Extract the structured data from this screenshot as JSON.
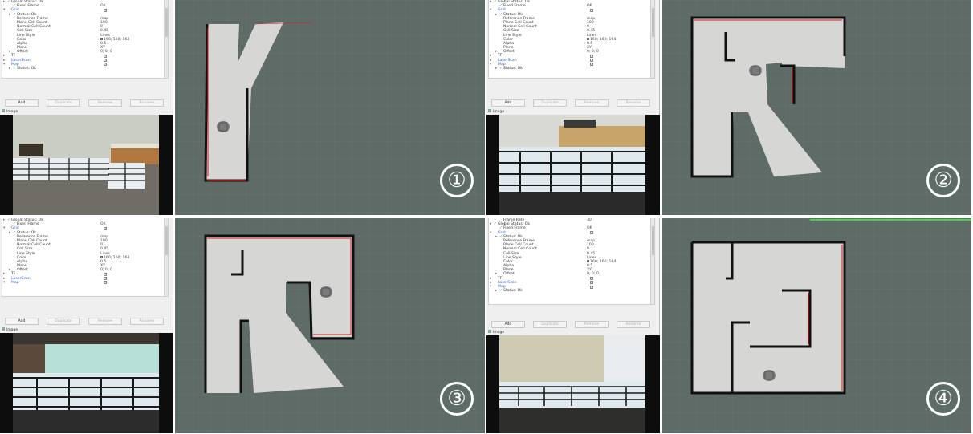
{
  "panels": [
    {
      "marker": "①",
      "tree": [
        {
          "indent": 0,
          "tw": "▸",
          "ck": "✓",
          "label": "Global Status: Ok",
          "value": ""
        },
        {
          "indent": 1,
          "tw": "",
          "ck": "✓",
          "label": "Fixed Frame",
          "value": "OK"
        },
        {
          "indent": 0,
          "tw": "▾",
          "ck": "",
          "label": "Grid",
          "value": "",
          "blue": true,
          "box": "✓"
        },
        {
          "indent": 1,
          "tw": "▸",
          "ck": "✓",
          "label": "Status: Ok",
          "value": ""
        },
        {
          "indent": 1,
          "tw": "",
          "ck": "",
          "label": "Reference Frame",
          "value": "map"
        },
        {
          "indent": 1,
          "tw": "",
          "ck": "",
          "label": "Plane Cell Count",
          "value": "100"
        },
        {
          "indent": 1,
          "tw": "",
          "ck": "",
          "label": "Normal Cell Count",
          "value": "0"
        },
        {
          "indent": 1,
          "tw": "",
          "ck": "",
          "label": "Cell Size",
          "value": "0.45"
        },
        {
          "indent": 1,
          "tw": "",
          "ck": "",
          "label": "Line Style",
          "value": "Lines"
        },
        {
          "indent": 1,
          "tw": "",
          "ck": "",
          "label": "Color",
          "value": "160; 160; 164",
          "swatch": true
        },
        {
          "indent": 1,
          "tw": "",
          "ck": "",
          "label": "Alpha",
          "value": "0.5"
        },
        {
          "indent": 1,
          "tw": "",
          "ck": "",
          "label": "Plane",
          "value": "XY"
        },
        {
          "indent": 1,
          "tw": "▸",
          "ck": "",
          "label": "Offset",
          "value": "0; 0; 0"
        },
        {
          "indent": 0,
          "tw": "▸",
          "ck": "",
          "label": "TF",
          "value": "",
          "box": "✓"
        },
        {
          "indent": 0,
          "tw": "▸",
          "ck": "",
          "label": "LaserScan",
          "value": "",
          "blue": true,
          "box": "✓"
        },
        {
          "indent": 0,
          "tw": "▾",
          "ck": "",
          "label": "Map",
          "value": "",
          "blue": true,
          "box": "✓"
        },
        {
          "indent": 1,
          "tw": "▸",
          "ck": "✓",
          "label": "Status: Ok",
          "value": ""
        }
      ]
    },
    {
      "marker": "②",
      "tree": [
        {
          "indent": 0,
          "tw": "▸",
          "ck": "✓",
          "label": "Global Status: Ok",
          "value": ""
        },
        {
          "indent": 1,
          "tw": "",
          "ck": "✓",
          "label": "Fixed Frame",
          "value": "OK"
        },
        {
          "indent": 0,
          "tw": "▾",
          "ck": "",
          "label": "Grid",
          "value": "",
          "blue": true,
          "box": "✓"
        },
        {
          "indent": 1,
          "tw": "▸",
          "ck": "✓",
          "label": "Status: Ok",
          "value": ""
        },
        {
          "indent": 1,
          "tw": "",
          "ck": "",
          "label": "Reference Frame",
          "value": "map"
        },
        {
          "indent": 1,
          "tw": "",
          "ck": "",
          "label": "Plane Cell Count",
          "value": "100"
        },
        {
          "indent": 1,
          "tw": "",
          "ck": "",
          "label": "Normal Cell Count",
          "value": "0"
        },
        {
          "indent": 1,
          "tw": "",
          "ck": "",
          "label": "Cell Size",
          "value": "0.45"
        },
        {
          "indent": 1,
          "tw": "",
          "ck": "",
          "label": "Line Style",
          "value": "Lines"
        },
        {
          "indent": 1,
          "tw": "",
          "ck": "",
          "label": "Color",
          "value": "160; 160; 164",
          "swatch": true
        },
        {
          "indent": 1,
          "tw": "",
          "ck": "",
          "label": "Alpha",
          "value": "0.5"
        },
        {
          "indent": 1,
          "tw": "",
          "ck": "",
          "label": "Plane",
          "value": "XY"
        },
        {
          "indent": 1,
          "tw": "▸",
          "ck": "",
          "label": "Offset",
          "value": "0; 0; 0"
        },
        {
          "indent": 0,
          "tw": "▸",
          "ck": "",
          "label": "TF",
          "value": "",
          "box": "✓"
        },
        {
          "indent": 0,
          "tw": "▸",
          "ck": "",
          "label": "LaserScan",
          "value": "",
          "blue": true,
          "box": "✓"
        },
        {
          "indent": 0,
          "tw": "▾",
          "ck": "",
          "label": "Map",
          "value": "",
          "blue": true,
          "box": "✓"
        },
        {
          "indent": 1,
          "tw": "▸",
          "ck": "✓",
          "label": "Status: Ok",
          "value": ""
        }
      ]
    },
    {
      "marker": "③",
      "tree": [
        {
          "indent": 0,
          "tw": "▸",
          "ck": "✓",
          "label": "Global Status: Ok",
          "value": ""
        },
        {
          "indent": 1,
          "tw": "",
          "ck": "✓",
          "label": "Fixed Frame",
          "value": "OK"
        },
        {
          "indent": 0,
          "tw": "▾",
          "ck": "",
          "label": "Grid",
          "value": "",
          "blue": true,
          "box": "✓"
        },
        {
          "indent": 1,
          "tw": "▸",
          "ck": "✓",
          "label": "Status: Ok",
          "value": ""
        },
        {
          "indent": 1,
          "tw": "",
          "ck": "",
          "label": "Reference Frame",
          "value": "map"
        },
        {
          "indent": 1,
          "tw": "",
          "ck": "",
          "label": "Plane Cell Count",
          "value": "100"
        },
        {
          "indent": 1,
          "tw": "",
          "ck": "",
          "label": "Normal Cell Count",
          "value": "0"
        },
        {
          "indent": 1,
          "tw": "",
          "ck": "",
          "label": "Cell Size",
          "value": "0.45"
        },
        {
          "indent": 1,
          "tw": "",
          "ck": "",
          "label": "Line Style",
          "value": "Lines"
        },
        {
          "indent": 1,
          "tw": "",
          "ck": "",
          "label": "Color",
          "value": "160; 160; 164",
          "swatch": true
        },
        {
          "indent": 1,
          "tw": "",
          "ck": "",
          "label": "Alpha",
          "value": "0.5"
        },
        {
          "indent": 1,
          "tw": "",
          "ck": "",
          "label": "Plane",
          "value": "XY"
        },
        {
          "indent": 1,
          "tw": "▸",
          "ck": "",
          "label": "Offset",
          "value": "0; 0; 0"
        },
        {
          "indent": 0,
          "tw": "▸",
          "ck": "",
          "label": "TF",
          "value": "",
          "box": "✓"
        },
        {
          "indent": 0,
          "tw": "▸",
          "ck": "",
          "label": "LaserScan",
          "value": "",
          "blue": true,
          "box": "✓"
        },
        {
          "indent": 0,
          "tw": "▾",
          "ck": "",
          "label": "Map",
          "value": "",
          "blue": true,
          "box": "✓"
        }
      ]
    },
    {
      "marker": "④",
      "tree": [
        {
          "indent": 1,
          "tw": "",
          "ck": "",
          "label": "Frame Rate",
          "value": "30"
        },
        {
          "indent": 0,
          "tw": "▸",
          "ck": "✓",
          "label": "Global Status: Ok",
          "value": ""
        },
        {
          "indent": 1,
          "tw": "",
          "ck": "✓",
          "label": "Fixed Frame",
          "value": "OK"
        },
        {
          "indent": 0,
          "tw": "▾",
          "ck": "",
          "label": "Grid",
          "value": "",
          "blue": true,
          "box": "✓"
        },
        {
          "indent": 1,
          "tw": "▸",
          "ck": "✓",
          "label": "Status: Ok",
          "value": ""
        },
        {
          "indent": 1,
          "tw": "",
          "ck": "",
          "label": "Reference Frame",
          "value": "map"
        },
        {
          "indent": 1,
          "tw": "",
          "ck": "",
          "label": "Plane Cell Count",
          "value": "100"
        },
        {
          "indent": 1,
          "tw": "",
          "ck": "",
          "label": "Normal Cell Count",
          "value": "0"
        },
        {
          "indent": 1,
          "tw": "",
          "ck": "",
          "label": "Cell Size",
          "value": "0.45"
        },
        {
          "indent": 1,
          "tw": "",
          "ck": "",
          "label": "Line Style",
          "value": "Lines"
        },
        {
          "indent": 1,
          "tw": "",
          "ck": "",
          "label": "Color",
          "value": "160; 160; 164",
          "swatch": true
        },
        {
          "indent": 1,
          "tw": "",
          "ck": "",
          "label": "Alpha",
          "value": "0.5"
        },
        {
          "indent": 1,
          "tw": "",
          "ck": "",
          "label": "Plane",
          "value": "XY"
        },
        {
          "indent": 1,
          "tw": "▸",
          "ck": "",
          "label": "Offset",
          "value": "0; 0; 0"
        },
        {
          "indent": 0,
          "tw": "▸",
          "ck": "",
          "label": "TF",
          "value": "",
          "box": "✓"
        },
        {
          "indent": 0,
          "tw": "▸",
          "ck": "",
          "label": "LaserScan",
          "value": "",
          "blue": true,
          "box": "✓"
        },
        {
          "indent": 0,
          "tw": "▾",
          "ck": "",
          "label": "Map",
          "value": "",
          "blue": true,
          "box": "✓"
        },
        {
          "indent": 1,
          "tw": "▸",
          "ck": "✓",
          "label": "Status: Ok",
          "value": ""
        }
      ]
    }
  ],
  "buttons": {
    "add": "Add",
    "duplicate": "Duplicate",
    "remove": "Remove",
    "rename": "Rename"
  },
  "image_panel_title": "Image",
  "colors": {
    "map_bg": "#5e6b66",
    "free_space": "#d6d6d4",
    "wall": "#111111",
    "scan": "#d42020",
    "robot": "#7a7a7a"
  },
  "icons": [
    "check-icon",
    "expand-arrow-icon",
    "image-panel-icon",
    "robot-marker-icon"
  ]
}
